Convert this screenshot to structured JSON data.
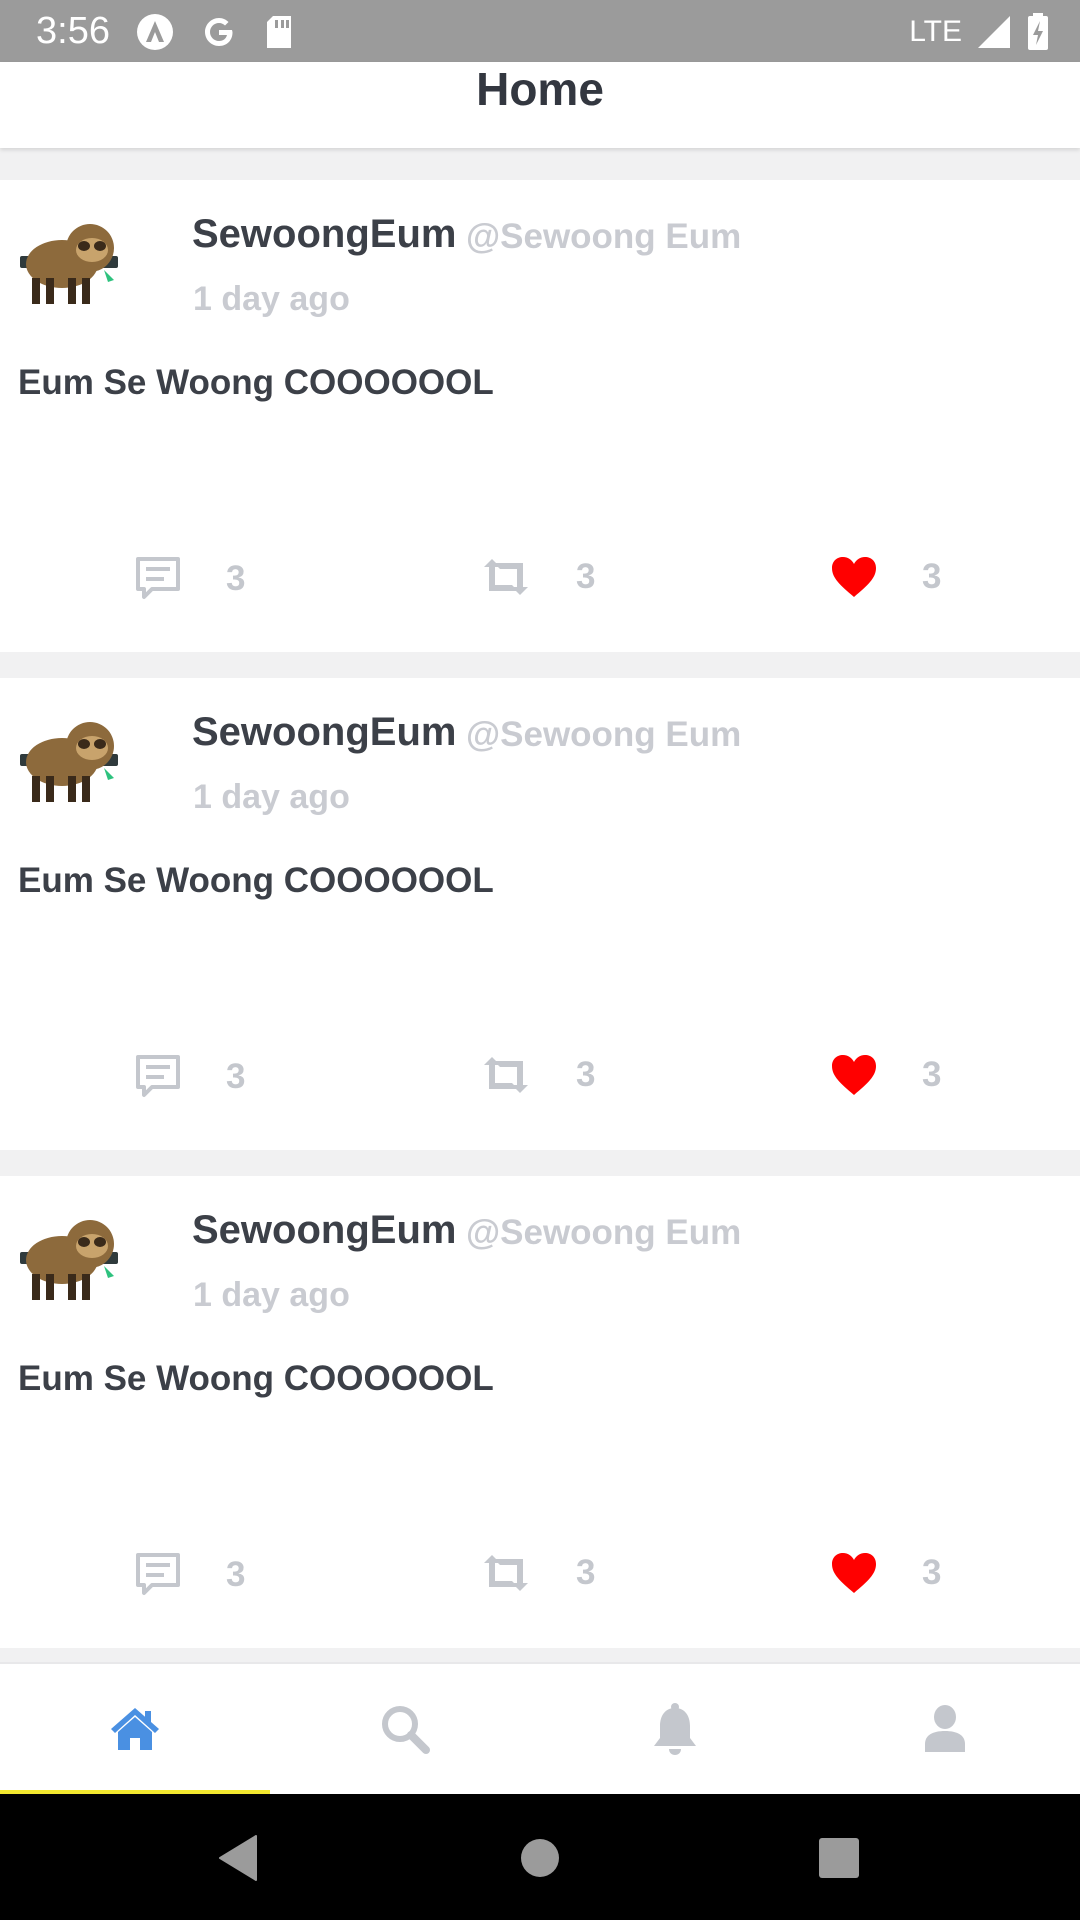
{
  "status_bar": {
    "time": "3:56",
    "network": "LTE",
    "icons": [
      "android-auto-icon",
      "google-icon",
      "sd-card-icon",
      "signal-icon",
      "battery-icon"
    ]
  },
  "header": {
    "title": "Home"
  },
  "tweets": [
    {
      "username": "SewoongEum",
      "handle": "@Sewoong Eum",
      "time": "1 day ago",
      "text": "Eum Se Woong COOOOOOL",
      "comments": "3",
      "retweets": "3",
      "likes": "3"
    },
    {
      "username": "SewoongEum",
      "handle": "@Sewoong Eum",
      "time": "1 day ago",
      "text": "Eum Se Woong COOOOOOL",
      "comments": "3",
      "retweets": "3",
      "likes": "3"
    },
    {
      "username": "SewoongEum",
      "handle": "@Sewoong Eum",
      "time": "1 day ago",
      "text": "Eum Se Woong COOOOOOL",
      "comments": "3",
      "retweets": "3",
      "likes": "3"
    }
  ],
  "tabs": [
    {
      "name": "home",
      "icon": "home-icon",
      "active": true
    },
    {
      "name": "search",
      "icon": "search-icon",
      "active": false
    },
    {
      "name": "notifications",
      "icon": "bell-icon",
      "active": false
    },
    {
      "name": "profile",
      "icon": "person-icon",
      "active": false
    }
  ],
  "colors": {
    "active_tab": "#4a90e2",
    "inactive_tab": "#c4c7cd",
    "tab_indicator": "#f2e72e",
    "like": "#ff0000",
    "muted_text": "#c9cbd1",
    "primary_text": "#3c4048"
  }
}
